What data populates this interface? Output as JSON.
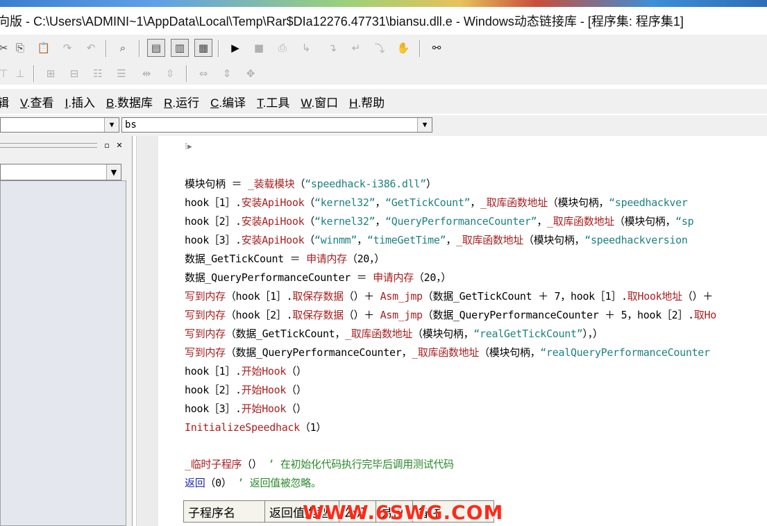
{
  "title": "向版 - C:\\Users\\ADMINI~1\\AppData\\Local\\Temp\\Rar$DIa12276.47731\\biansu.dll.e - Windows动态链接库 - [程序集: 程序集1]",
  "colors": {
    "keyword": "#aa2020",
    "string": "#1e8080",
    "comment": "#2a8a2a",
    "blue": "#1a2ab0",
    "watermark": "#ff2a18"
  },
  "toolbar1": {
    "icons": [
      "cut-icon",
      "copy-icon",
      "paste-icon",
      "redo-icon",
      "undo-icon",
      "find-icon",
      "layout-icon-1",
      "layout-icon-2",
      "layout-icon-3",
      "run-icon",
      "stop-icon",
      "step-icon-1",
      "step-icon-2",
      "step-icon-3",
      "step-icon-4",
      "step-icon-5",
      "hand-icon",
      "binoculars-icon"
    ]
  },
  "toolbar2": {
    "icons": [
      "align-icon-1",
      "align-icon-2",
      "align-icon-3",
      "align-icon-4",
      "align-icon-5",
      "align-icon-6",
      "align-icon-7",
      "size-icon-1",
      "size-icon-2",
      "size-icon-3"
    ]
  },
  "menu": [
    {
      "key": "",
      "label": "辑"
    },
    {
      "key": "V",
      "label": ".查看"
    },
    {
      "key": "I",
      "label": ".插入"
    },
    {
      "key": "B",
      "label": ".数据库"
    },
    {
      "key": "R",
      "label": ".运行"
    },
    {
      "key": "C",
      "label": ".编译"
    },
    {
      "key": "T",
      "label": ".工具"
    },
    {
      "key": "W",
      "label": ".窗口"
    },
    {
      "key": "H",
      "label": ".帮助"
    }
  ],
  "combo_left": {
    "value": ""
  },
  "combo_right": {
    "value": "bs"
  },
  "code": {
    "l1a": "模块句柄 ＝ ",
    "l1b": "_装载模块",
    "l1c": "（",
    "l1d": "“speedhack-i386.dll”",
    "l1e": "）",
    "l2a": "hook［1］.",
    "l2b": "安装ApiHook",
    "l2c": "（",
    "l2d": "“kernel32”",
    "l2e": "，",
    "l2f": "“GetTickCount”",
    "l2g": "，",
    "l2h": "_取库函数地址",
    "l2i": "（模块句柄，",
    "l2j": "“speedhackver",
    "l3a": "hook［2］.",
    "l3b": "安装ApiHook",
    "l3c": "（",
    "l3d": "“kernel32”",
    "l3e": "，",
    "l3f": "“QueryPerformanceCounter”",
    "l3g": "，",
    "l3h": "_取库函数地址",
    "l3i": "（模块句柄，",
    "l3j": "“sp",
    "l4a": "hook［3］.",
    "l4b": "安装ApiHook",
    "l4c": "（",
    "l4d": "“winmm”",
    "l4e": "，",
    "l4f": "“timeGetTime”",
    "l4g": "，",
    "l4h": "_取库函数地址",
    "l4i": "（模块句柄，",
    "l4j": "“speedhackversion",
    "l5a": "数据_GetTickCount ＝ ",
    "l5b": "申请内存",
    "l5c": "（20，）",
    "l6a": "数据_QueryPerformanceCounter ＝ ",
    "l6b": "申请内存",
    "l6c": "（20，）",
    "l7a": "写到内存",
    "l7b": "（hook［1］.",
    "l7c": "取保存数据",
    "l7d": "（）＋ ",
    "l7e": "Asm_jmp",
    "l7f": "（数据_GetTickCount ＋ 7，hook［1］.",
    "l7g": "取Hook地址",
    "l7h": "（）＋",
    "l8a": "写到内存",
    "l8b": "（hook［2］.",
    "l8c": "取保存数据",
    "l8d": "（）＋ ",
    "l8e": "Asm_jmp",
    "l8f": "（数据_QueryPerformanceCounter ＋ 5，hook［2］.",
    "l8g": "取Ho",
    "l9a": "写到内存",
    "l9b": "（数据_GetTickCount，",
    "l9c": "_取库函数地址",
    "l9d": "（模块句柄，",
    "l9e": "“realGetTickCount”",
    "l9f": "），）",
    "l10a": "写到内存",
    "l10b": "（数据_QueryPerformanceCounter，",
    "l10c": "_取库函数地址",
    "l10d": "（模块句柄，",
    "l10e": "“realQueryPerformanceCounter",
    "l11a": "hook［1］.",
    "l11b": "开始Hook",
    "l11c": "（）",
    "l12a": "hook［2］.",
    "l12b": "开始Hook",
    "l12c": "（）",
    "l13a": "hook［3］.",
    "l13b": "开始Hook",
    "l13c": "（）",
    "l14a": "InitializeSpeedhack",
    "l14b": "（1）",
    "l15a": "_临时子程序",
    "l15b": "（）",
    "l15c": " ’ 在初始化代码执行完毕后调用测试代码",
    "l16a": "返回",
    "l16b": "（0）",
    "l16c": " ’ 返回值被忽略。"
  },
  "subtable": {
    "headers": [
      "子程序名",
      "返回值类型",
      "公开",
      "易包",
      "备注"
    ]
  },
  "watermark": "WWW.6SWG.COM"
}
